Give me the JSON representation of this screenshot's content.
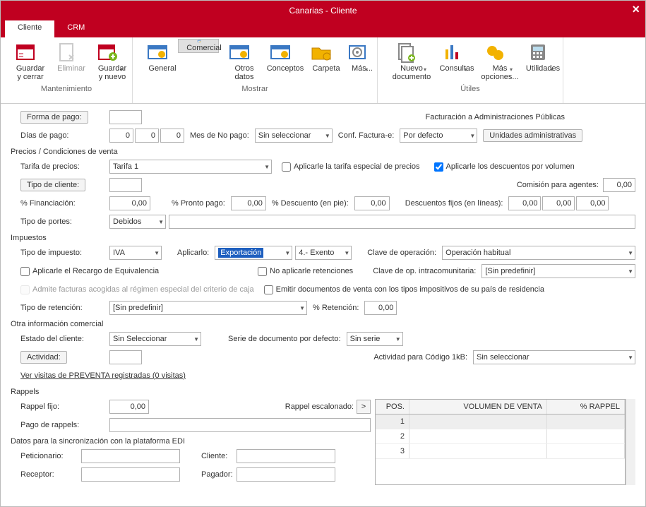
{
  "window": {
    "title": "Canarias - Cliente"
  },
  "tabs": {
    "cliente": "Cliente",
    "crm": "CRM"
  },
  "ribbon": {
    "mantenimiento": {
      "label": "Mantenimiento",
      "guardar_cerrar": "Guardar\ny cerrar",
      "eliminar": "Eliminar",
      "guardar_nuevo": "Guardar\ny nuevo"
    },
    "mostrar": {
      "label": "Mostrar",
      "general": "General",
      "comercial": "Comercial",
      "otros": "Otros\ndatos",
      "conceptos": "Conceptos",
      "carpeta": "Carpeta",
      "mas": "Más..."
    },
    "utiles": {
      "label": "Útiles",
      "nuevo_doc": "Nuevo\ndocumento",
      "consultas": "Consultas",
      "mas_op": "Más\nopciones...",
      "utilidades": "Utilidades"
    }
  },
  "pago": {
    "forma_btn": "Forma de pago:",
    "dias_lbl": "Días de pago:",
    "d1": "0",
    "d2": "0",
    "d3": "0",
    "mes_no_lbl": "Mes de No pago:",
    "mes_no_val": "Sin seleccionar",
    "fact_pub": "Facturación a Administraciones Públicas",
    "conf_lbl": "Conf. Factura-e:",
    "conf_val": "Por defecto",
    "unid_btn": "Unidades administrativas"
  },
  "precios": {
    "sect": "Precios / Condiciones de venta",
    "tarifa_lbl": "Tarifa de precios:",
    "tarifa_val": "Tarifa 1",
    "tipo_cliente_btn": "Tipo de cliente:",
    "aplicar_especial": "Aplicarle la tarifa especial de precios",
    "aplicar_vol": "Aplicarle los descuentos por volumen",
    "comision_lbl": "Comisión para agentes:",
    "comision_val": "0,00",
    "fin_lbl": "% Financiación:",
    "fin_val": "0,00",
    "pronto_lbl": "% Pronto pago:",
    "pronto_val": "0,00",
    "desc_pie_lbl": "% Descuento (en pie):",
    "desc_pie_val": "0,00",
    "desc_fijo_lbl": "Descuentos fijos (en líneas):",
    "df1": "0,00",
    "df2": "0,00",
    "df3": "0,00",
    "portes_lbl": "Tipo de portes:",
    "portes_val": "Debidos"
  },
  "imp": {
    "sect": "Impuestos",
    "tipo_lbl": "Tipo de impuesto:",
    "tipo_val": "IVA",
    "aplicarlo_lbl": "Aplicarlo:",
    "aplicarlo_val": "Exportación",
    "exento_val": "4.- Exento",
    "clave_op_lbl": "Clave de operación:",
    "clave_op_val": "Operación habitual",
    "recargo": "Aplicarle el Recargo de Equivalencia",
    "no_ret": "No aplicarle retenciones",
    "clave_intra_lbl": "Clave de op. intracomunitaria:",
    "clave_intra_val": "[Sin predefinir]",
    "admite": "Admite facturas acogidas al régimen especial del criterio de caja",
    "emitir": "Emitir documentos de venta con los tipos impositivos de su país de residencia",
    "ret_lbl": "Tipo de retención:",
    "ret_val": "[Sin predefinir]",
    "pct_ret_lbl": "% Retención:",
    "pct_ret_val": "0,00"
  },
  "otra": {
    "sect": "Otra información comercial",
    "estado_lbl": "Estado del cliente:",
    "estado_val": "Sin Seleccionar",
    "serie_lbl": "Serie de documento por defecto:",
    "serie_val": "Sin serie",
    "actividad_btn": "Actividad:",
    "act1kb_lbl": "Actividad para Código 1kB:",
    "act1kb_val": "Sin seleccionar",
    "visitas": "Ver visitas de PREVENTA registradas (0 visitas)"
  },
  "rappels": {
    "sect": "Rappels",
    "fijo_lbl": "Rappel fijo:",
    "fijo_val": "0,00",
    "esc_lbl": "Rappel escalonado:",
    "pago_lbl": "Pago de rappels:",
    "col_pos": "POS.",
    "col_vol": "VOLUMEN DE VENTA",
    "col_pct": "% RAPPEL",
    "r1": "1",
    "r2": "2",
    "r3": "3"
  },
  "edi": {
    "sect": "Datos para la sincronización con la plataforma EDI",
    "peticionario": "Peticionario:",
    "cliente": "Cliente:",
    "receptor": "Receptor:",
    "pagador": "Pagador:"
  }
}
